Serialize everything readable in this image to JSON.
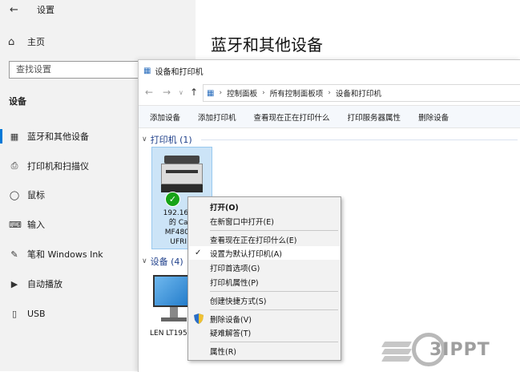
{
  "settings": {
    "window_title": "设置",
    "home_label": "主页",
    "search_placeholder": "查找设置",
    "section_label": "设备",
    "nav_items": [
      {
        "label": "蓝牙和其他设备",
        "icon": "bluetooth-devices-icon",
        "active": true
      },
      {
        "label": "打印机和扫描仪",
        "icon": "printer-icon",
        "active": false
      },
      {
        "label": "鼠标",
        "icon": "mouse-icon",
        "active": false
      },
      {
        "label": "输入",
        "icon": "keyboard-icon",
        "active": false
      },
      {
        "label": "笔和 Windows Ink",
        "icon": "pen-icon",
        "active": false
      },
      {
        "label": "自动播放",
        "icon": "autoplay-icon",
        "active": false
      },
      {
        "label": "USB",
        "icon": "usb-icon",
        "active": false
      }
    ],
    "page_heading": "蓝牙和其他设备",
    "accent_color": "#0078d7"
  },
  "explorer": {
    "title": "设备和打印机",
    "breadcrumb": [
      "控制面板",
      "所有控制面板项",
      "设备和打印机"
    ],
    "commands": [
      "添加设备",
      "添加打印机",
      "查看现在正在打印什么",
      "打印服务器属性",
      "删除设备"
    ],
    "printers_group": "打印机 (1)",
    "printer_label": [
      "192.168.3.",
      "的 Canc",
      "MF4800 S",
      "UFRII L"
    ],
    "devices_group": "设备 (4)",
    "monitor_label": "LEN LT195"
  },
  "context_menu": {
    "items": [
      {
        "label": "打开(O)",
        "bold": true
      },
      {
        "label": "在新窗口中打开(E)"
      },
      {
        "label": "查看现在正在打印什么(E)"
      },
      {
        "label": "设置为默认打印机(A)",
        "checked": true,
        "highlight": true
      },
      {
        "label": "打印首选项(G)"
      },
      {
        "label": "打印机属性(P)"
      },
      {
        "label": "创建快捷方式(S)"
      },
      {
        "label": "删除设备(V)",
        "icon": "shield-icon"
      },
      {
        "label": "疑难解答(T)"
      },
      {
        "label": "属性(R)"
      }
    ]
  },
  "watermark": {
    "text": "3IPPT"
  }
}
